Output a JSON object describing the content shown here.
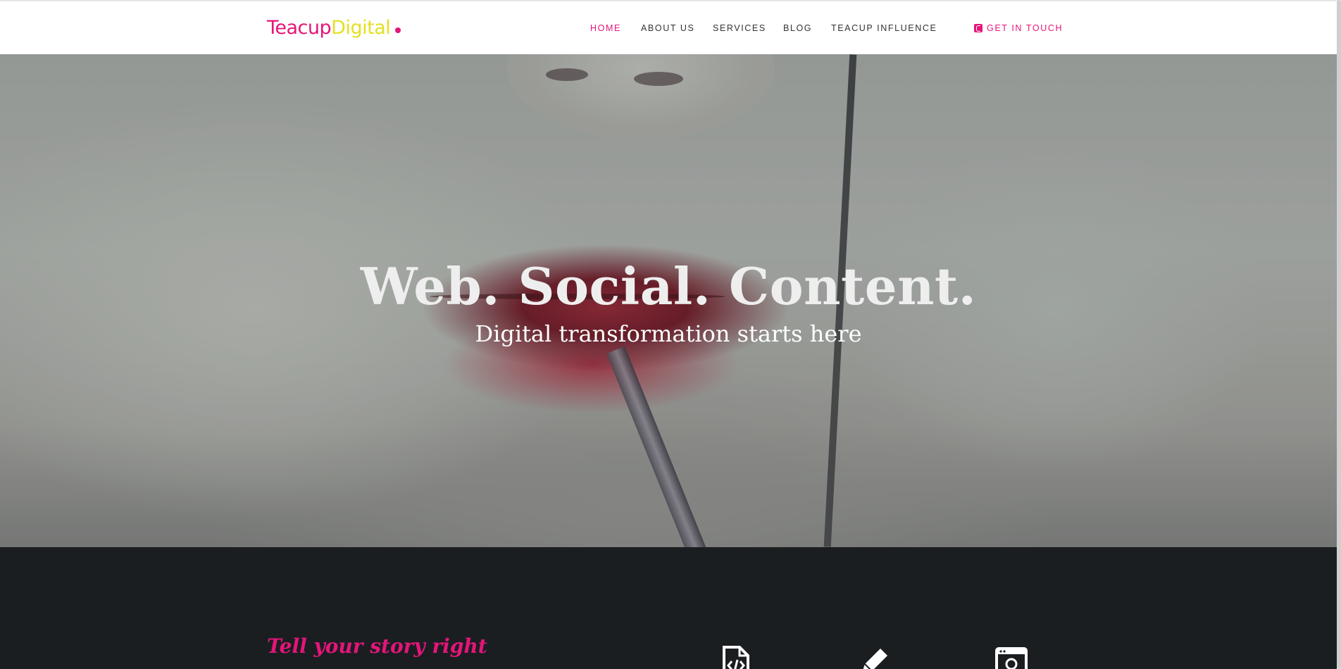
{
  "brand": {
    "name_part1": "Teacup",
    "name_part2": "Digital",
    "colors": {
      "pink": "#e5157a",
      "yellow": "#e3e023",
      "dark": "#1b1e21"
    }
  },
  "nav": {
    "items": [
      {
        "label": "HOME",
        "active": true
      },
      {
        "label": "ABOUT US"
      },
      {
        "label": "SERVICES"
      },
      {
        "label": "BLOG"
      },
      {
        "label": "TEACUP INFLUENCE"
      }
    ],
    "contact": {
      "label": "GET IN TOUCH",
      "icon": "phone-icon"
    }
  },
  "hero": {
    "title": "Web. Social. Content.",
    "subtitle": "Digital transformation starts here"
  },
  "intro": {
    "heading": "Tell your story right",
    "icons": [
      "document-code-icon",
      "pencil-icon",
      "browser-icon"
    ]
  }
}
